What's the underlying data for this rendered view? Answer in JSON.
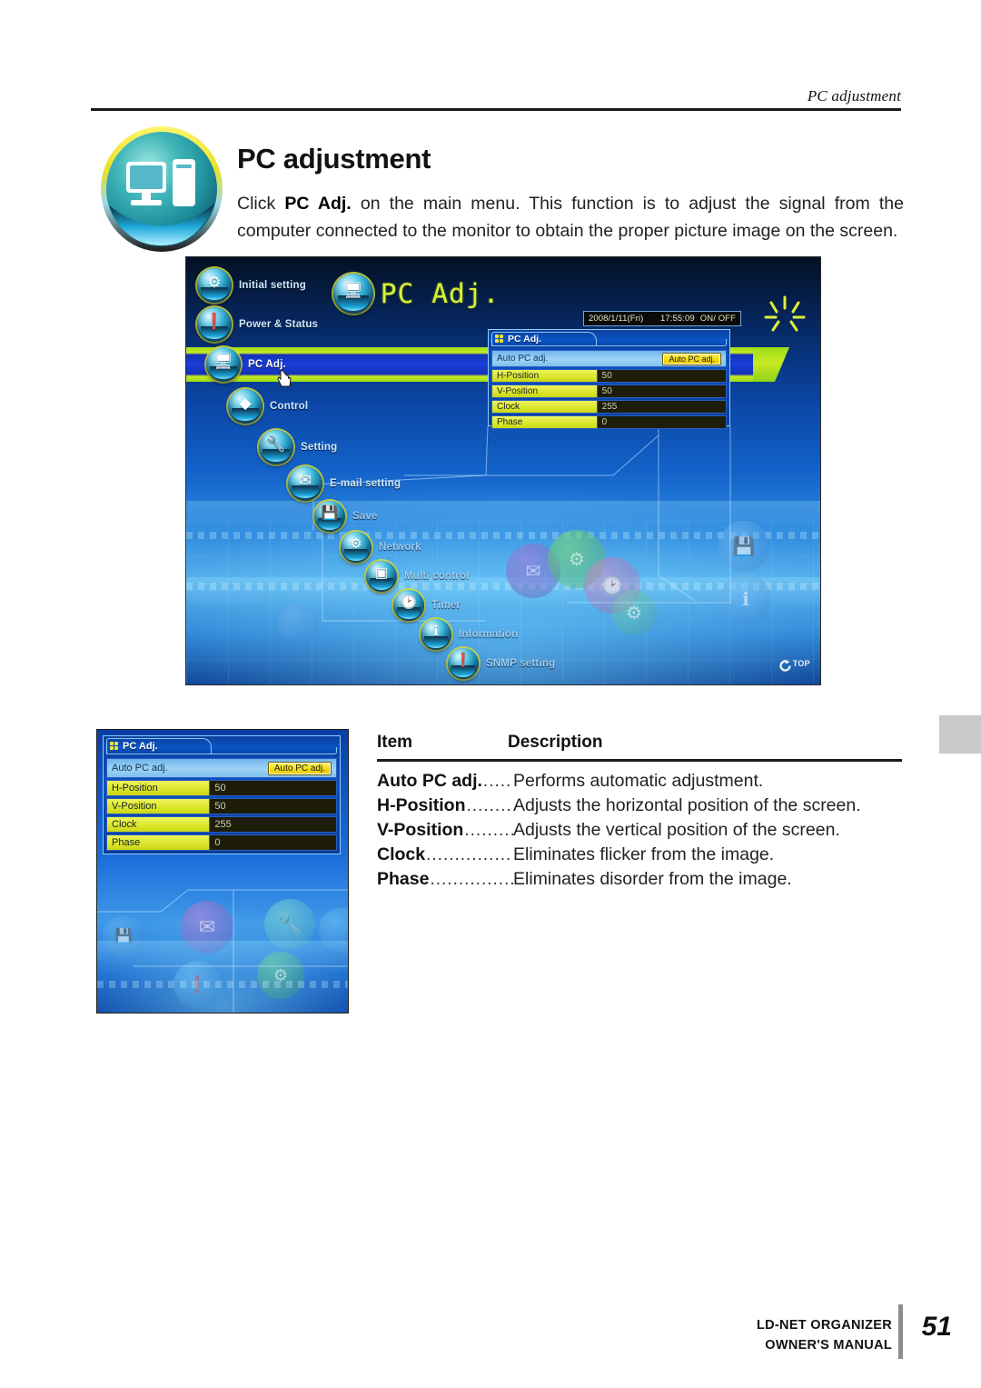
{
  "running_header": {
    "text": "PC adjustment"
  },
  "title": {
    "heading": "PC adjustment",
    "badge_icon": "monitor-and-tower-icon"
  },
  "intro": {
    "before_bold": "Click ",
    "bold": "PC Adj.",
    "after_bold": " on the main menu. This function is to adjust the signal from the computer connected to the monitor to obtain the proper picture image on the screen."
  },
  "app_screenshot": {
    "logo_label": "PC Adj.",
    "logo_icon": "monitor-and-tower-icon",
    "status_bar": {
      "date": "2008/1/11(Fri)",
      "time": "17:55:09",
      "power": "ON/ OFF"
    },
    "menu": [
      {
        "label": "Initial setting",
        "icon": "gear-projector-icon",
        "selected": false
      },
      {
        "label": "Power & Status",
        "icon": "power-status-icon",
        "selected": false
      },
      {
        "label": "PC Adj.",
        "icon": "monitor-and-tower-icon",
        "selected": true
      },
      {
        "label": "Control",
        "icon": "dpad-arrows-icon",
        "selected": false
      },
      {
        "label": "Setting",
        "icon": "wrench-screwdriver-icon",
        "selected": false
      },
      {
        "label": "E-mail setting",
        "icon": "envelope-icon",
        "selected": false
      },
      {
        "label": "Save",
        "icon": "floppy-disk-icon",
        "selected": false
      },
      {
        "label": "Network",
        "icon": "network-icon",
        "selected": false
      },
      {
        "label": "Multi control",
        "icon": "multi-projector-icon",
        "selected": false
      },
      {
        "label": "Timer",
        "icon": "clock-icon",
        "selected": false
      },
      {
        "label": "Information",
        "icon": "info-icon",
        "selected": false
      },
      {
        "label": "SNMP setting",
        "icon": "snmp-alert-icon",
        "selected": false
      }
    ],
    "panel": {
      "title": "PC Adj.",
      "title_icon": "four-dots-icon",
      "auto_row_label": "Auto PC adj.",
      "auto_button_label": "Auto PC adj.",
      "rows": [
        {
          "label": "H-Position",
          "value": "50"
        },
        {
          "label": "V-Position",
          "value": "50"
        },
        {
          "label": "Clock",
          "value": "255"
        },
        {
          "label": "Phase",
          "value": "0"
        }
      ]
    },
    "top_button": {
      "label": "TOP",
      "icon": "refresh-arrow-icon"
    }
  },
  "detail_crop": {
    "panel": {
      "title": "PC Adj.",
      "title_icon": "four-dots-icon",
      "auto_row_label": "Auto PC adj.",
      "auto_button_label": "Auto PC adj.",
      "rows": [
        {
          "label": "H-Position",
          "value": "50"
        },
        {
          "label": "V-Position",
          "value": "50"
        },
        {
          "label": "Clock",
          "value": "255"
        },
        {
          "label": "Phase",
          "value": "0"
        }
      ]
    }
  },
  "description_table": {
    "headers": {
      "item": "Item",
      "description": "Description"
    },
    "rows": [
      {
        "item": "Auto PC adj.",
        "dots": "..........",
        "description": "Performs automatic adjustment."
      },
      {
        "item": "H-Position",
        "dots": "............",
        "description": "Adjusts the horizontal position of the screen."
      },
      {
        "item": "V-Position",
        "dots": " ............",
        "description": "Adjusts the vertical position of the screen."
      },
      {
        "item": "Clock",
        "dots": " ......................",
        "description": "Eliminates flicker from the image."
      },
      {
        "item": "Phase",
        "dots": "........................",
        "description": "Eliminates disorder from the image."
      }
    ]
  },
  "footer": {
    "brand_line1": "LD-NET ORGANIZER",
    "brand_line2": "OWNER'S MANUAL",
    "page_number": "51"
  },
  "colors": {
    "accent_yellow": "#d8f03a",
    "panel_blue": "#0c4fbe",
    "row_yellow": "#dbe62a",
    "value_dark": "#1e1d08",
    "highlight_green": "#9ade1b",
    "highlight_blue": "#1a3ed8"
  }
}
